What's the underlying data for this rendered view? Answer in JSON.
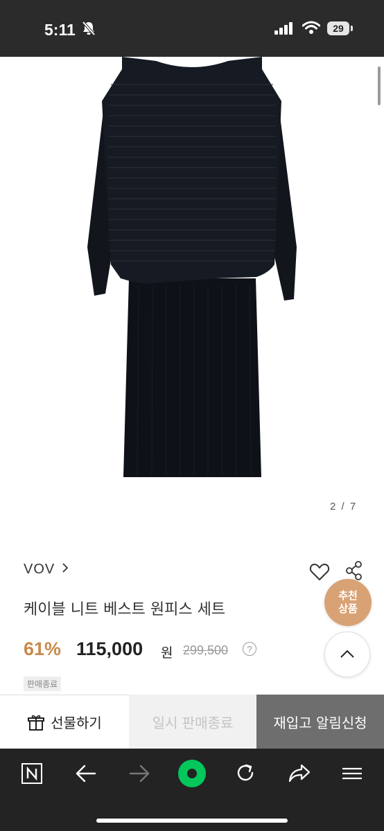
{
  "status_bar": {
    "time": "5:11",
    "battery_level": "29"
  },
  "image": {
    "counter": "2 / 7"
  },
  "product": {
    "brand": "VOV",
    "name": "케이블 니트 베스트 원피스 세트",
    "discount": "61%",
    "sale_price": "115,000",
    "currency": "원",
    "original_price": "299,500",
    "badge": "판매종료"
  },
  "floating": {
    "recommend_line1": "추천",
    "recommend_line2": "상품"
  },
  "actions": {
    "gift": "선물하기",
    "paused": "일시 판매종료",
    "restock": "재입고 알림신청"
  },
  "colors": {
    "discount": "#c98a4b",
    "recommend": "#d9a275",
    "naver_green": "#03c75a",
    "restock_bg": "#6e6e6e"
  }
}
